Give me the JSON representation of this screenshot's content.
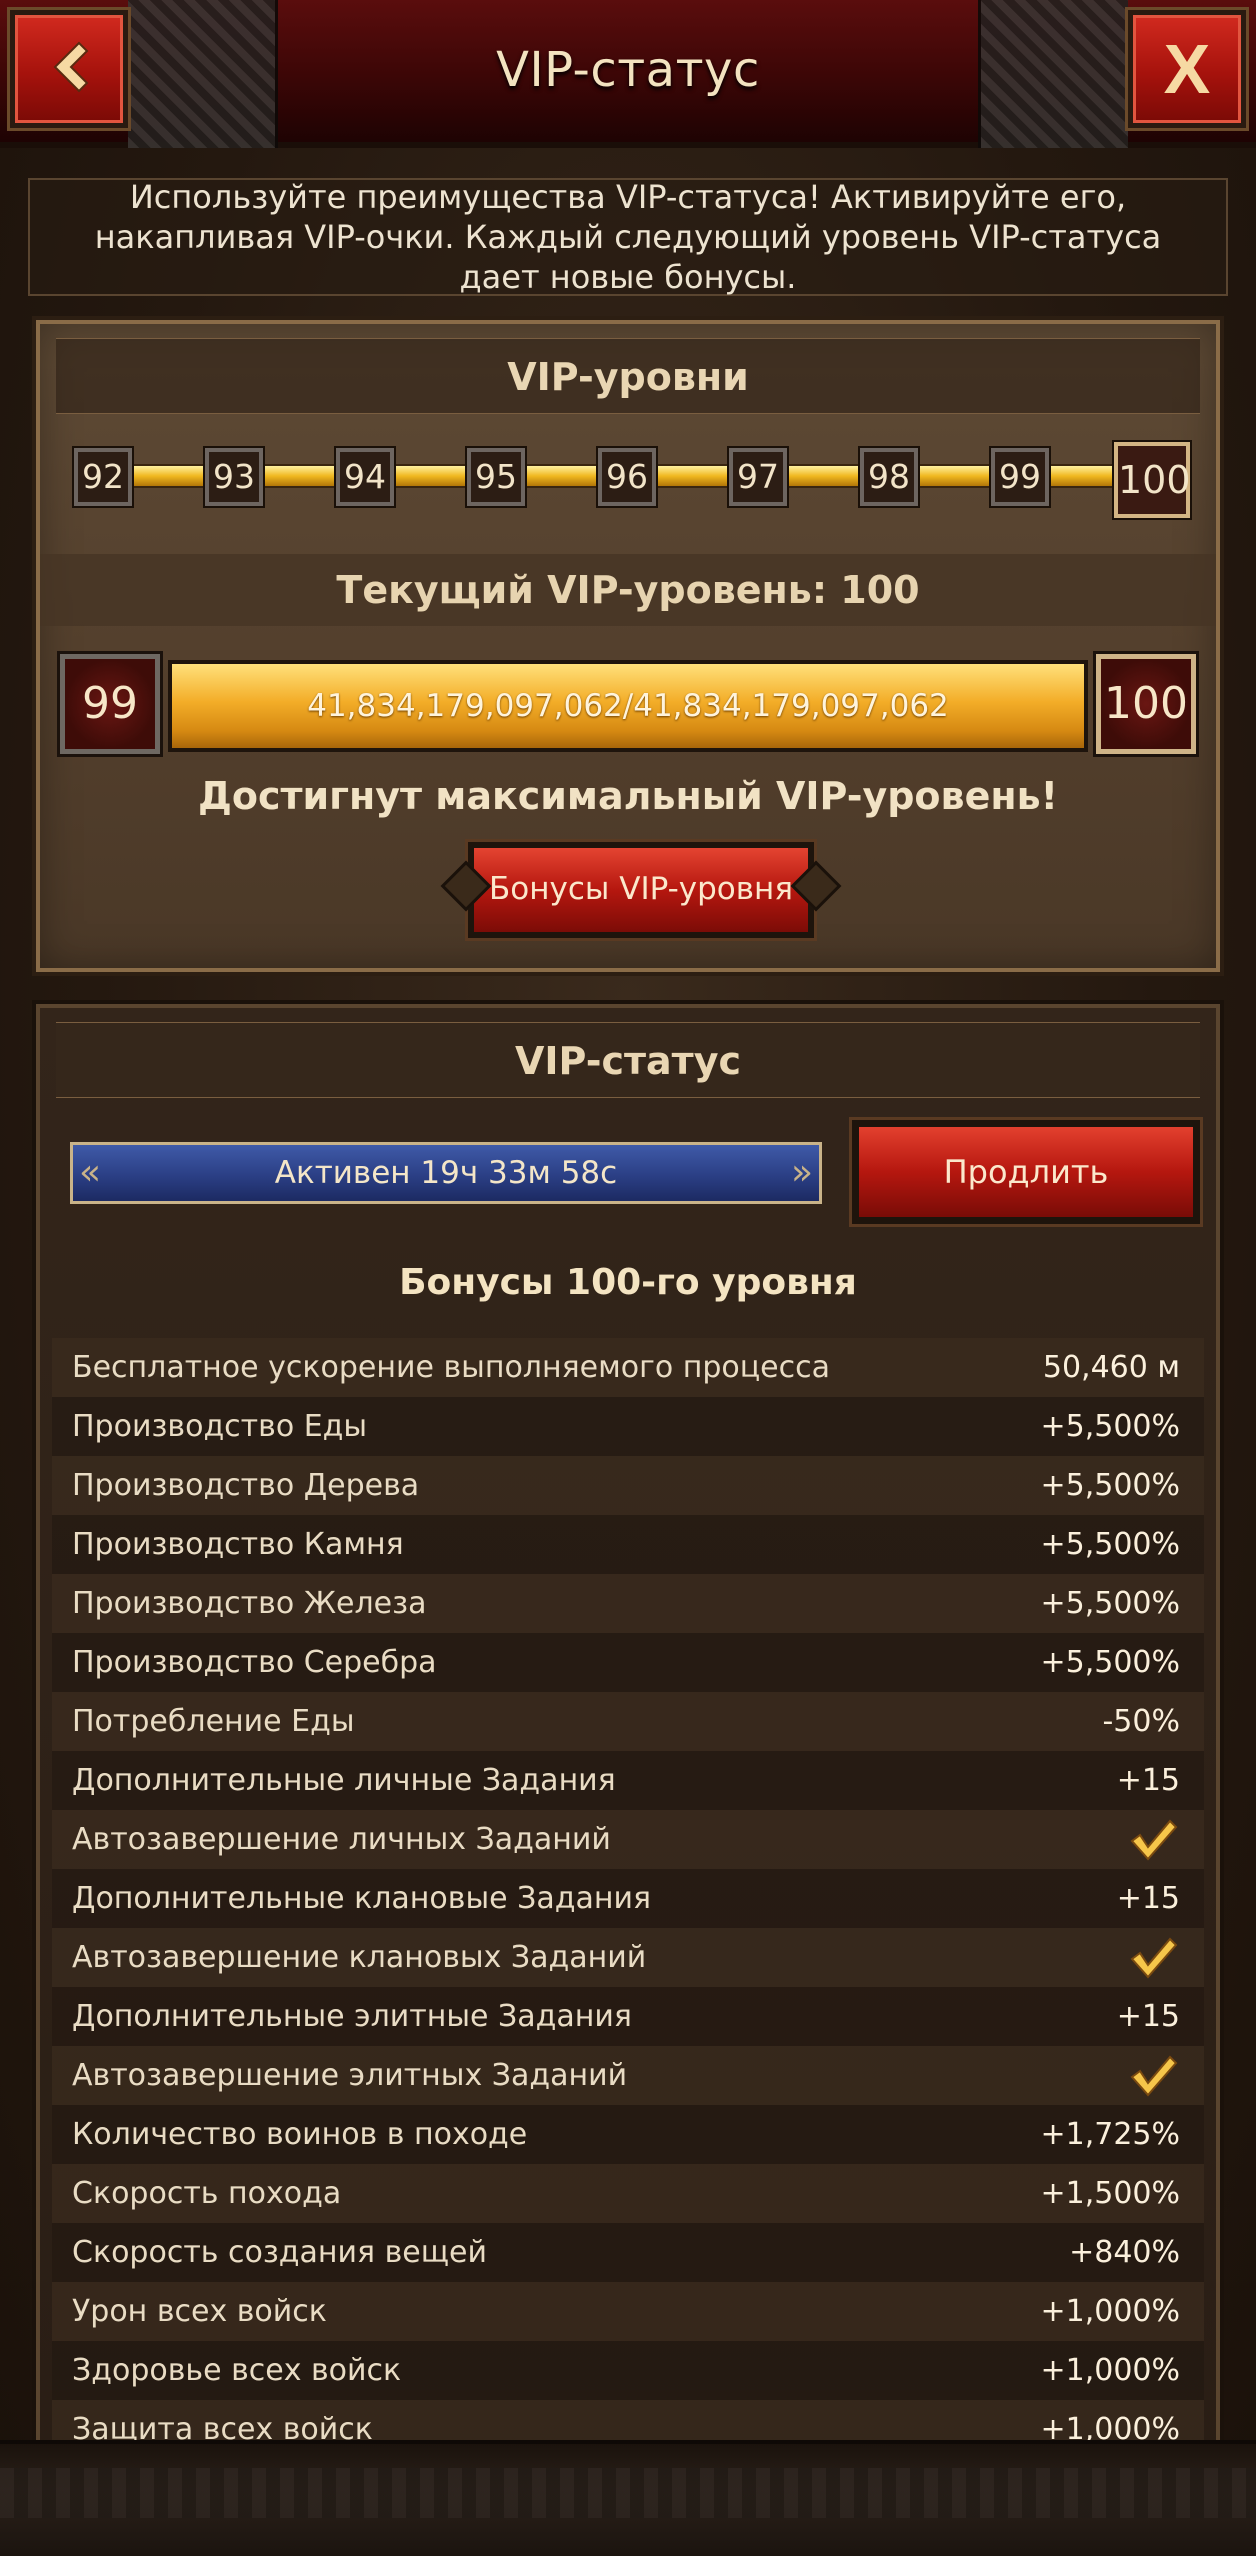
{
  "header": {
    "title": "VIP-статус",
    "back_label": "",
    "close_label": "X"
  },
  "info": {
    "text": "Используйте преимущества VIP-статуса! Активируйте его, накапливая VIP-очки. Каждый следующий уровень VIP-статуса дает новые бонусы."
  },
  "levels": {
    "title": "VIP-уровни",
    "track": [
      "92",
      "93",
      "94",
      "95",
      "96",
      "97",
      "98",
      "99",
      "100"
    ],
    "current_label": "Текущий VIP-уровень: 100",
    "prev_level": "99",
    "next_level": "100",
    "progress_text": "41,834,179,097,062/41,834,179,097,062",
    "progress_fraction": 1.0,
    "max_text": "Достигнут максимальный VIP-уровень!",
    "bonus_button": "Бонусы VIP-уровня"
  },
  "status": {
    "title": "VIP-статус",
    "active_text": "Активен 19ч 33м 58с",
    "extend_button": "Продлить",
    "bonus_heading": "Бонусы 100-го уровня",
    "rows": [
      {
        "label": "Бесплатное ускорение выполняемого процесса",
        "value": "50,460 м"
      },
      {
        "label": "Производство Еды",
        "value": "+5,500%"
      },
      {
        "label": "Производство Дерева",
        "value": "+5,500%"
      },
      {
        "label": "Производство Камня",
        "value": "+5,500%"
      },
      {
        "label": "Производство Железа",
        "value": "+5,500%"
      },
      {
        "label": "Производство Серебра",
        "value": "+5,500%"
      },
      {
        "label": "Потребление Еды",
        "value": "-50%"
      },
      {
        "label": "Дополнительные личные Задания",
        "value": "+15"
      },
      {
        "label": "Автозавершение личных Заданий",
        "value": "",
        "check": true
      },
      {
        "label": "Дополнительные клановые Задания",
        "value": "+15"
      },
      {
        "label": "Автозавершение клановых Заданий",
        "value": "",
        "check": true
      },
      {
        "label": "Дополнительные элитные Задания",
        "value": "+15"
      },
      {
        "label": "Автозавершение элитных Заданий",
        "value": "",
        "check": true
      },
      {
        "label": "Количество воинов в походе",
        "value": "+1,725%"
      },
      {
        "label": "Скорость похода",
        "value": "+1,500%"
      },
      {
        "label": "Скорость создания вещей",
        "value": "+840%"
      },
      {
        "label": "Урон всех войск",
        "value": "+1,000%"
      },
      {
        "label": "Здоровье всех войск",
        "value": "+1,000%"
      },
      {
        "label": "Защита всех войск",
        "value": "+1,000%"
      }
    ]
  },
  "colors": {
    "accent_red": "#b5170f",
    "gold": "#f0b820",
    "active_blue": "#2b3f85",
    "check": "#f6c64a"
  },
  "icons": {
    "back": "chevron-left-icon",
    "close": "close-icon",
    "check": "checkmark-icon"
  }
}
